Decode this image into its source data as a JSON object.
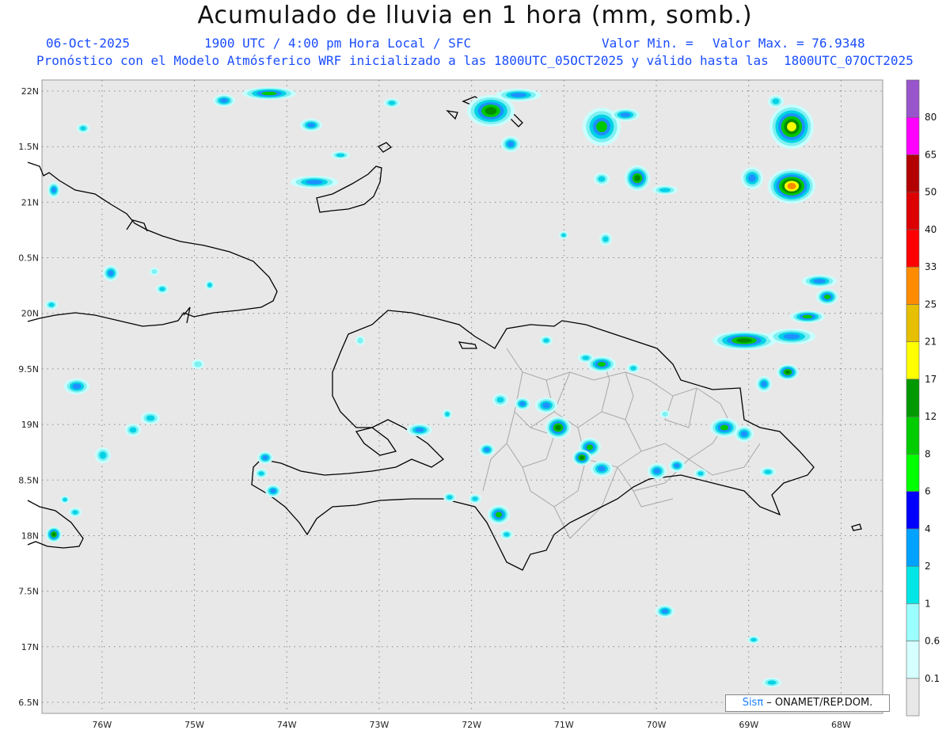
{
  "title": "Acumulado de lluvia en 1 hora (mm, somb.)",
  "header": {
    "date": "06-Oct-2025",
    "time_info": "1900 UTC / 4:00 pm Hora Local / SFC",
    "min_label": "Valor Min. =",
    "max_label": "Valor Max. = 76.9348",
    "model_info": "Pronóstico con el Modelo Atmósferico WRF inicializado a las 1800UTC_05OCT2025 y válido hasta las  1800UTC_07OCT2025"
  },
  "map": {
    "lon_range": [
      -76.65,
      -67.55
    ],
    "lat_range": [
      16.4,
      22.1
    ],
    "lon_ticks": [
      {
        "value": -76,
        "label": "76W"
      },
      {
        "value": -75,
        "label": "75W"
      },
      {
        "value": -74,
        "label": "74W"
      },
      {
        "value": -73,
        "label": "73W"
      },
      {
        "value": -72,
        "label": "72W"
      },
      {
        "value": -71,
        "label": "71W"
      },
      {
        "value": -70,
        "label": "70W"
      },
      {
        "value": -69,
        "label": "69W"
      },
      {
        "value": -68,
        "label": "68W"
      }
    ],
    "lat_ticks": [
      {
        "value": 22,
        "label": "22N"
      },
      {
        "value": 21.5,
        "label": "1.5N"
      },
      {
        "value": 21,
        "label": "21N"
      },
      {
        "value": 20.5,
        "label": "0.5N"
      },
      {
        "value": 20,
        "label": "20N"
      },
      {
        "value": 19.5,
        "label": "9.5N"
      },
      {
        "value": 19,
        "label": "19N"
      },
      {
        "value": 18.5,
        "label": "8.5N"
      },
      {
        "value": 18,
        "label": "18N"
      },
      {
        "value": 17.5,
        "label": "7.5N"
      },
      {
        "value": 17,
        "label": "17N"
      },
      {
        "value": 16.5,
        "label": "6.5N"
      }
    ],
    "background_color": "#e8e8e8",
    "coast_color": "#000000",
    "province_color": "#a8a8a8"
  },
  "colorbar": {
    "labels": [
      "0.1",
      "0.6",
      "1",
      "2",
      "4",
      "6",
      "8",
      "12",
      "17",
      "21",
      "25",
      "33",
      "40",
      "50",
      "65",
      "80"
    ],
    "colors": [
      "#e8e8e8",
      "#d6ffff",
      "#9cffff",
      "#00e6e6",
      "#00a2ff",
      "#0000ff",
      "#00ff00",
      "#00cc00",
      "#009900",
      "#ffff00",
      "#e6bf00",
      "#ff8c00",
      "#ff0000",
      "#dd0000",
      "#b30000",
      "#ff00ff",
      "#9955cc"
    ]
  },
  "credit": {
    "brand": "Sisπ",
    "text": " – ONAMET/REP.DOM."
  }
}
